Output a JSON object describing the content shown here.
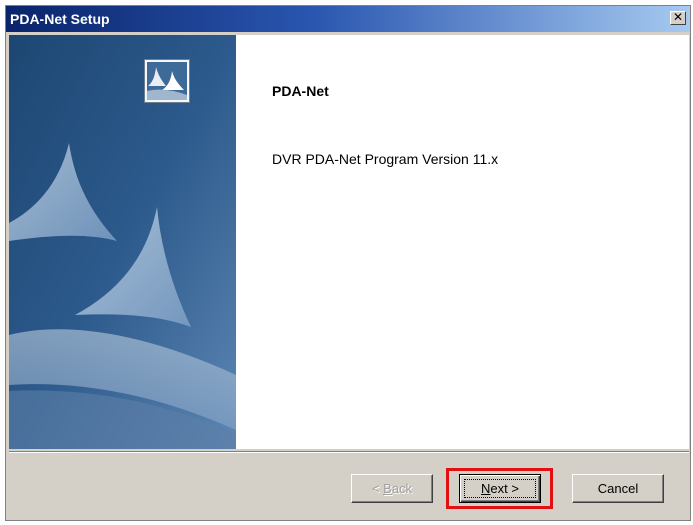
{
  "window": {
    "title": "PDA-Net Setup",
    "close_symbol": "✕"
  },
  "content": {
    "heading": "PDA-Net",
    "description": "DVR PDA-Net Program Version 11.x"
  },
  "buttons": {
    "back": {
      "arrow": "< ",
      "mnemonic": "B",
      "rest": "ack",
      "enabled": false
    },
    "next": {
      "mnemonic": "N",
      "rest": "ext >",
      "focused": true
    },
    "cancel": "Cancel"
  },
  "colors": {
    "title_bar": "#0a246a",
    "highlight": "#e21010",
    "banner": "#2c5a8c"
  },
  "icons": {
    "setup": "setup-sails-icon"
  }
}
